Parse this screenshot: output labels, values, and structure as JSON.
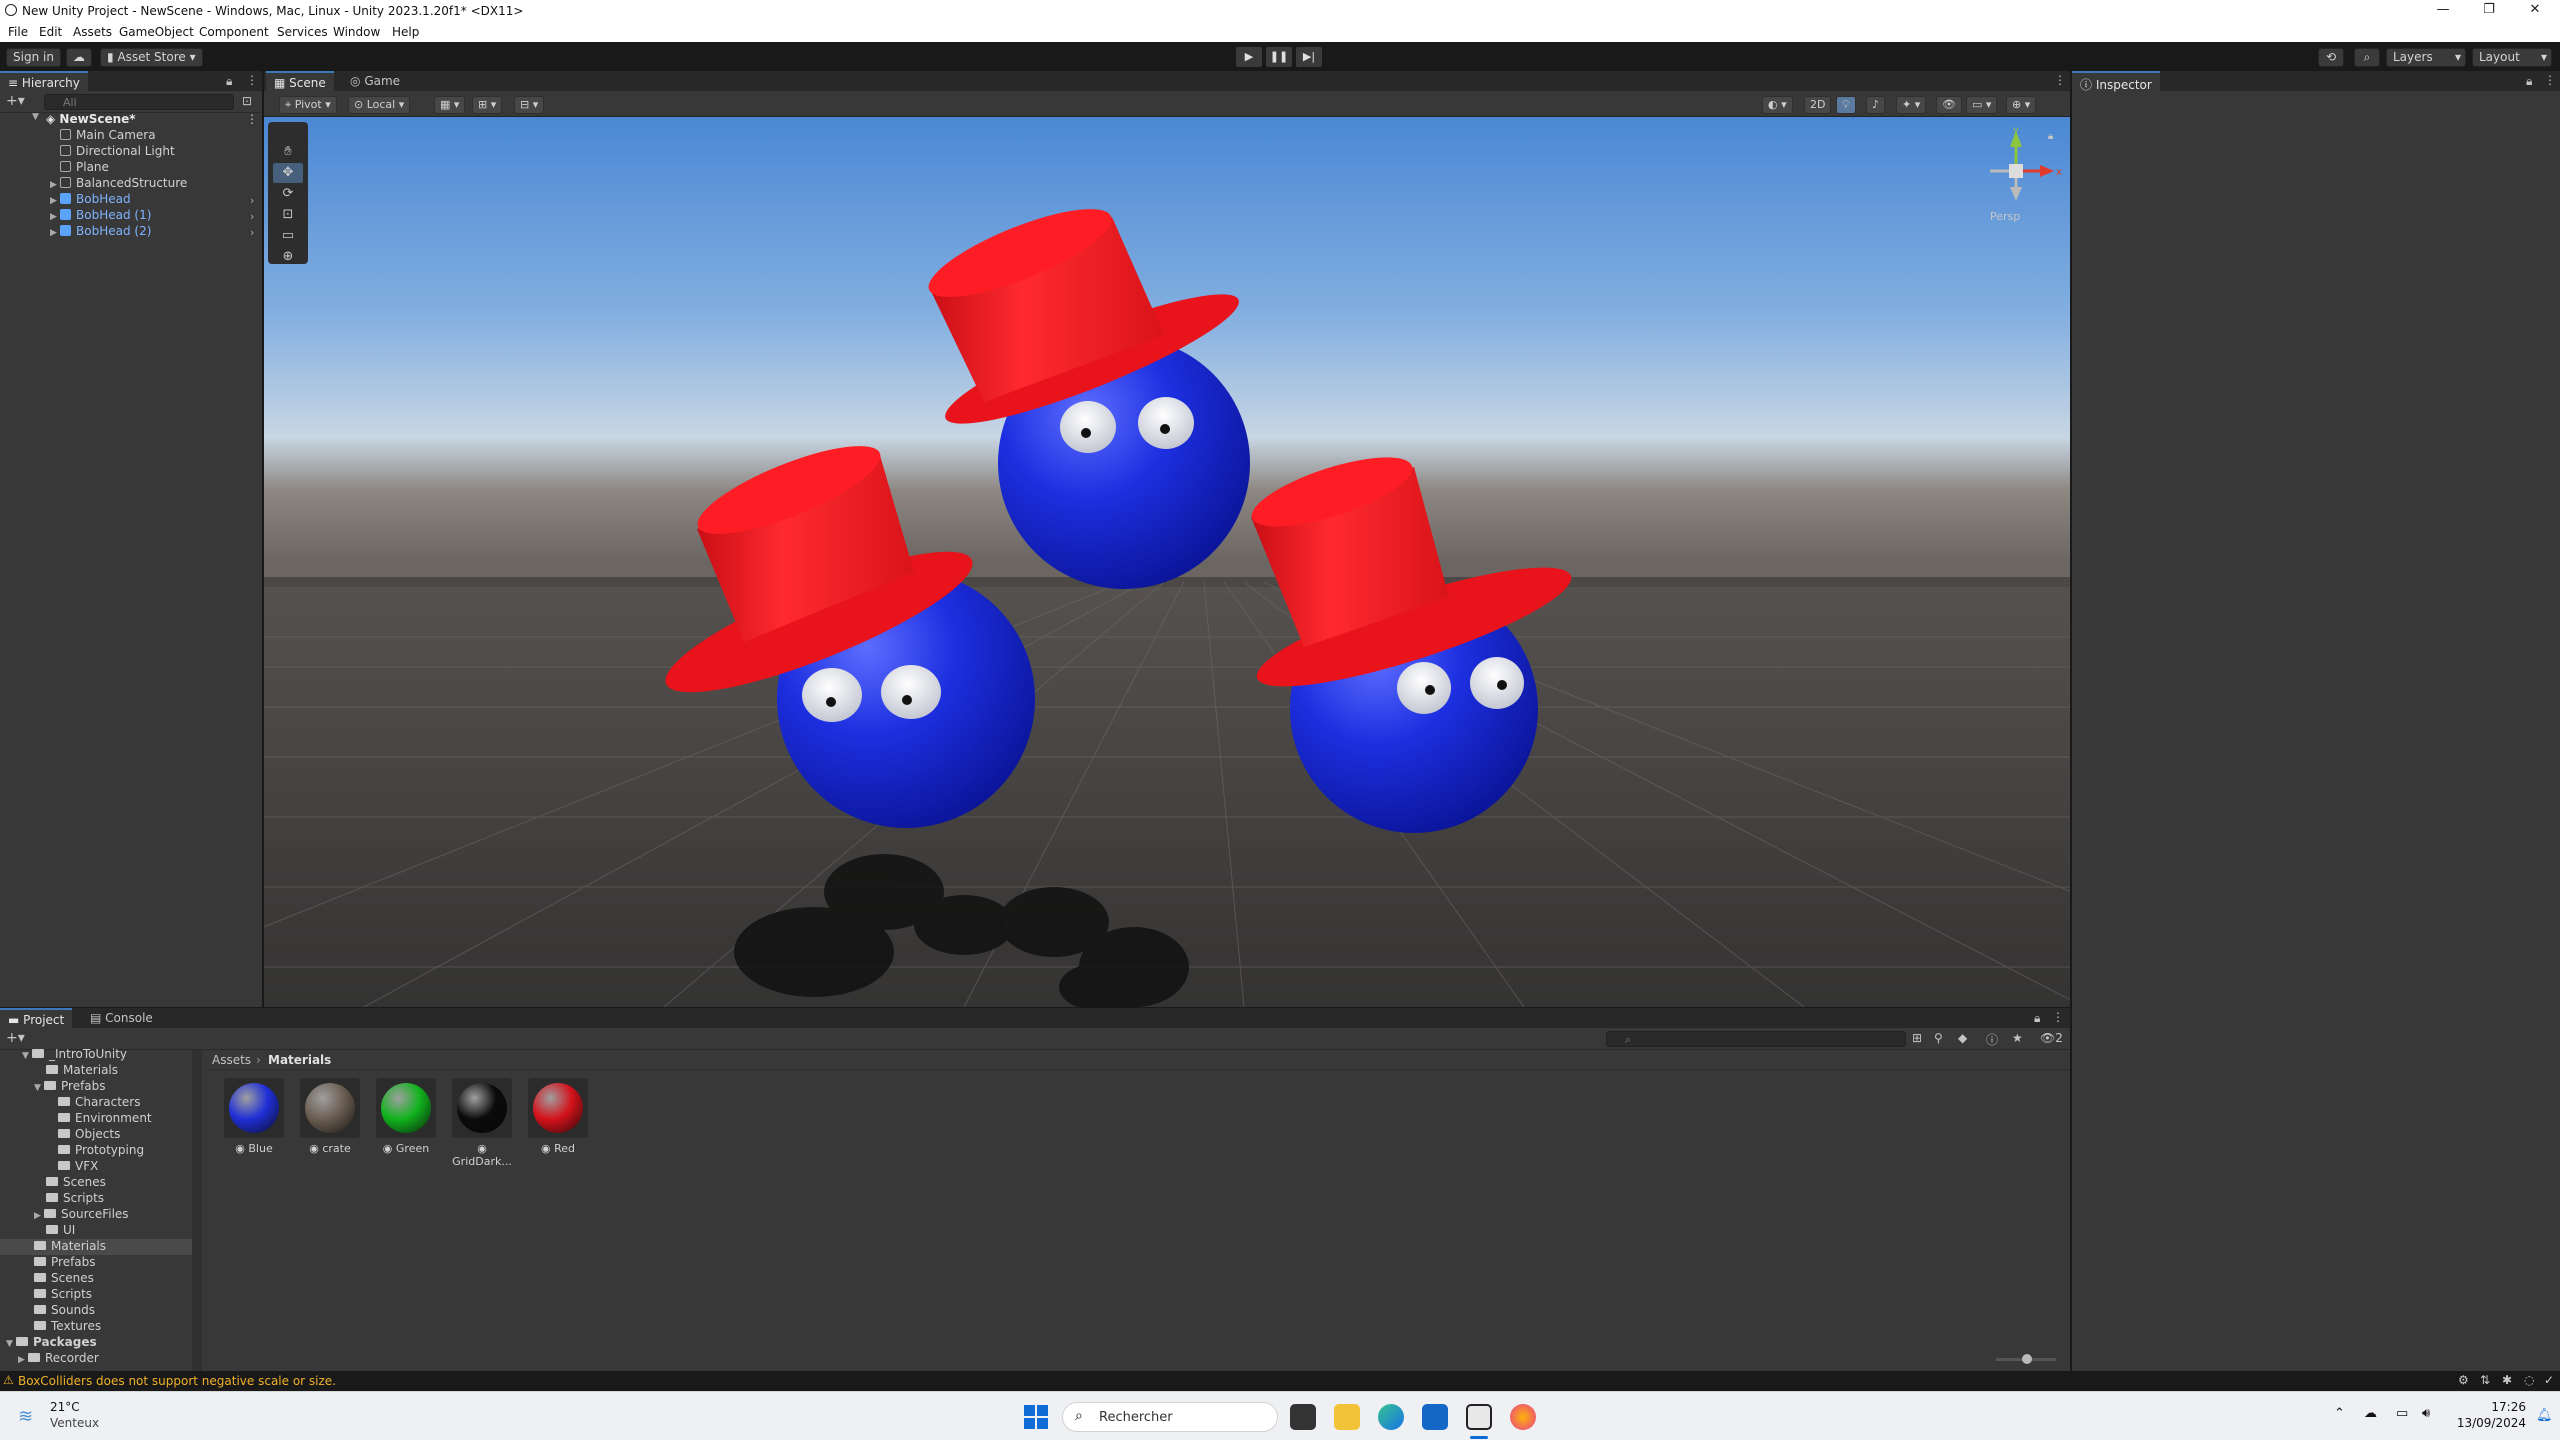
{
  "window": {
    "title": "New Unity Project - NewScene - Windows, Mac, Linux - Unity 2023.1.20f1* <DX11>"
  },
  "menu": [
    "File",
    "Edit",
    "Assets",
    "GameObject",
    "Component",
    "Services",
    "Window",
    "Help"
  ],
  "toolbar": {
    "sign_in": "Sign in",
    "asset_store": "Asset Store",
    "layers": "Layers",
    "layout": "Layout"
  },
  "hierarchy": {
    "tab": "Hierarchy",
    "search_placeholder": "All",
    "scene": "NewScene*",
    "items": [
      {
        "label": "Main Camera",
        "prefab": false
      },
      {
        "label": "Directional Light",
        "prefab": false
      },
      {
        "label": "Plane",
        "prefab": false
      },
      {
        "label": "BalancedStructure",
        "prefab": false
      },
      {
        "label": "BobHead",
        "prefab": true
      },
      {
        "label": "BobHead (1)",
        "prefab": true
      },
      {
        "label": "BobHead (2)",
        "prefab": true
      }
    ]
  },
  "scene": {
    "tabs": [
      "Scene",
      "Game"
    ],
    "pivot": "Pivot",
    "local": "Local",
    "mode_2d": "2D",
    "persp": "Persp"
  },
  "inspector": {
    "tab": "Inspector"
  },
  "project": {
    "tabs": [
      "Project",
      "Console"
    ],
    "breadcrumb_root": "Assets",
    "breadcrumb_current": "Materials",
    "tree": [
      {
        "label": "_IntroToUnity"
      },
      {
        "label": "Materials"
      },
      {
        "label": "Prefabs"
      },
      {
        "label": "Characters"
      },
      {
        "label": "Environment"
      },
      {
        "label": "Objects"
      },
      {
        "label": "Prototyping"
      },
      {
        "label": "VFX"
      },
      {
        "label": "Scenes"
      },
      {
        "label": "Scripts"
      },
      {
        "label": "SourceFiles"
      },
      {
        "label": "UI"
      },
      {
        "label": "Materials"
      },
      {
        "label": "Prefabs"
      },
      {
        "label": "Scenes"
      },
      {
        "label": "Scripts"
      },
      {
        "label": "Sounds"
      },
      {
        "label": "Textures"
      },
      {
        "label": "Packages"
      },
      {
        "label": "Recorder"
      }
    ],
    "assets": [
      {
        "label": "Blue",
        "color": "#1f2fd6"
      },
      {
        "label": "crate",
        "color": "#6b5e52"
      },
      {
        "label": "Green",
        "color": "#12b31e"
      },
      {
        "label": "GridDark...",
        "color": "#0b0b0b"
      },
      {
        "label": "Red",
        "color": "#d4121b"
      }
    ],
    "hidden_count": "2"
  },
  "status": {
    "message": "BoxColliders does not support negative scale or size."
  },
  "taskbar": {
    "temperature": "21°C",
    "weather": "Venteux",
    "search": "Rechercher",
    "time": "17:26",
    "date": "13/09/2024"
  }
}
